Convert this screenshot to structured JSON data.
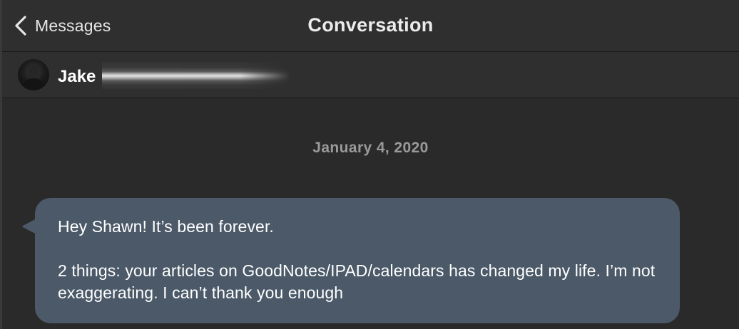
{
  "nav": {
    "back_label": "Messages",
    "title": "Conversation"
  },
  "contact": {
    "name": "Jake"
  },
  "thread": {
    "date": "January 4, 2020",
    "messages": [
      {
        "lines": [
          "Hey Shawn! It’s been forever.",
          "2 things: your articles on GoodNotes/IPAD/calendars has changed my life. I’m not exaggerating. I can’t thank you enough"
        ]
      }
    ]
  },
  "colors": {
    "background": "#2a2a2a",
    "header": "#2f2f2f",
    "bubble": "#4b5968",
    "date_text": "#9a9a9a"
  },
  "icons": {
    "back": "chevron-left-icon",
    "avatar": "contact-avatar"
  }
}
